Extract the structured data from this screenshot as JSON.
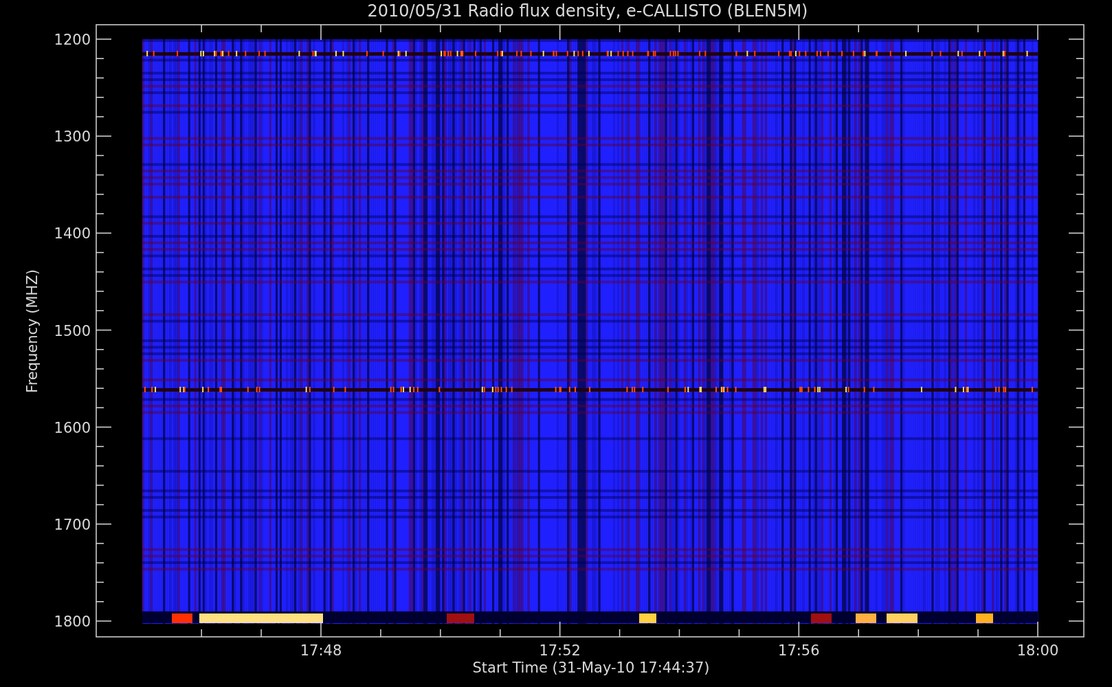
{
  "title": "2010/05/31  Radio flux density, e-CALLISTO (BLEN5M)",
  "y_axis": {
    "label": "Frequency (MHZ)",
    "ticks": [
      "1200",
      "1300",
      "1400",
      "1500",
      "1600",
      "1700",
      "1800"
    ]
  },
  "x_axis": {
    "label": "Start Time (31-May-10 17:44:37)",
    "ticks": [
      "17:48",
      "17:52",
      "17:56",
      "18:00"
    ]
  }
}
